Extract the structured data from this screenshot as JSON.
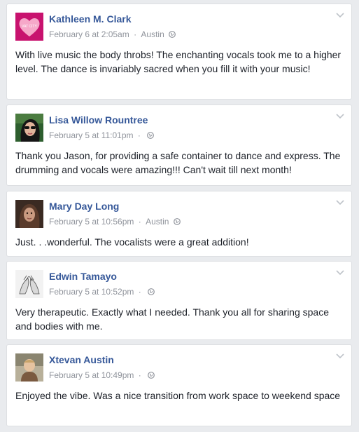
{
  "posts": [
    {
      "author": "Kathleen M. Clark",
      "date": "February 6 at 2:05am",
      "location": "Austin",
      "text": "With live music the body throbs! The enchanting vocals took me to a higher level. The dance is invariably sacred when you fill it with your music!",
      "avatar_icon": "heart-avatar",
      "avatar_text": "VAT CITY"
    },
    {
      "author": "Lisa Willow Rountree",
      "date": "February 5 at 11:01pm",
      "location": "",
      "text": "Thank you Jason, for providing a safe container to dance and express. The drumming and vocals were amazing!!! Can't wait till next month!",
      "avatar_icon": "woman-sunglasses-avatar"
    },
    {
      "author": "Mary Day Long",
      "date": "February 5 at 10:56pm",
      "location": "Austin",
      "text": "Just. . .wonderful. The vocalists were a great addition!",
      "avatar_icon": "woman-portrait-avatar"
    },
    {
      "author": "Edwin Tamayo",
      "date": "February 5 at 10:52pm",
      "location": "",
      "text": "Very therapeutic. Exactly what I needed. Thank you all for sharing space and bodies with me.",
      "avatar_icon": "hands-avatar"
    },
    {
      "author": "Xtevan Austin",
      "date": "February 5 at 10:49pm",
      "location": "",
      "text": "Enjoyed the vibe. Was a nice transition from work space to weekend space",
      "avatar_icon": "child-photo-avatar"
    }
  ],
  "separator": "·",
  "colors": {
    "name": "#365899",
    "meta": "#90949c",
    "text": "#1d2129",
    "background": "#e9ebee"
  }
}
